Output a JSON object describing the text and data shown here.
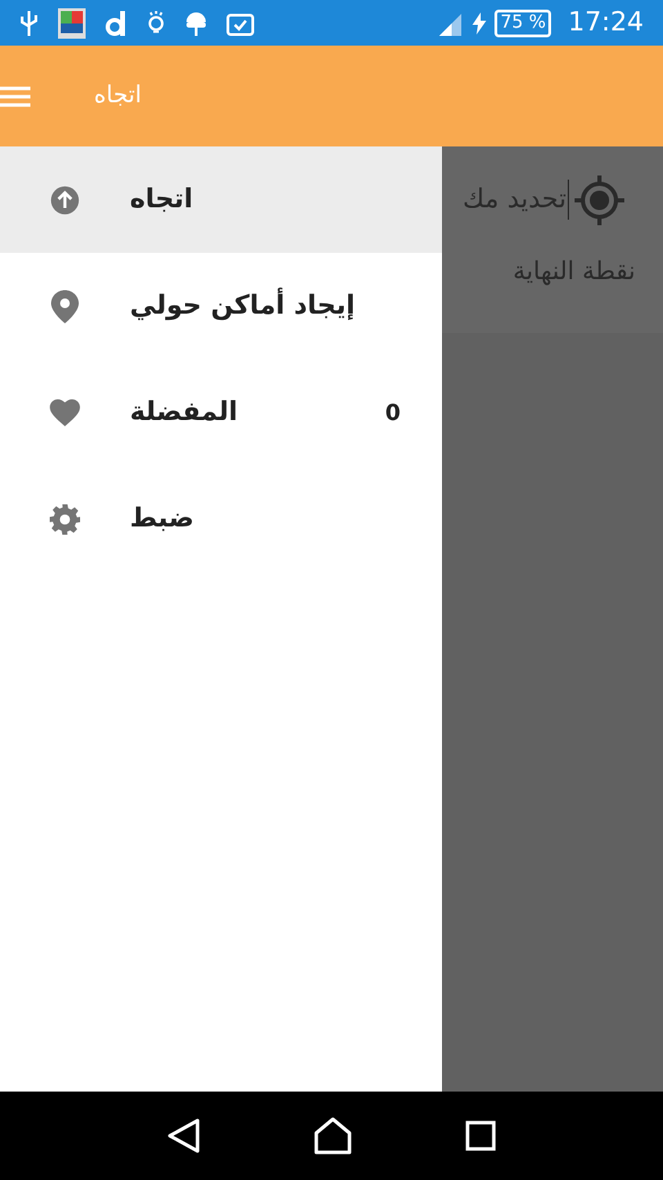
{
  "status_bar": {
    "battery": "75 %",
    "time": "17:24"
  },
  "toolbar": {
    "title": "اتجاه"
  },
  "drawer": {
    "items": [
      {
        "kind": "direction",
        "label": "اتجاه",
        "selected": true
      },
      {
        "kind": "place",
        "label": "إيجاد أماكن حولي",
        "selected": false
      },
      {
        "kind": "favorite",
        "label": "المفضلة",
        "selected": false,
        "count": "0"
      },
      {
        "kind": "settings",
        "label": "ضبط",
        "selected": false
      }
    ]
  },
  "content": {
    "location_field": {
      "value": "تحديد مك"
    },
    "destination_field": {
      "placeholder": "نقطة النهاية"
    }
  }
}
